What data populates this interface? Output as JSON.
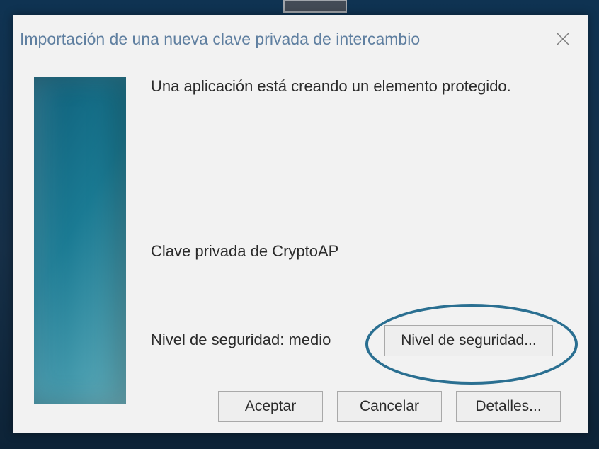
{
  "dialog": {
    "title": "Importación de una nueva clave privada de intercambio",
    "message": "Una aplicación está creando un elemento protegido.",
    "subject": "Clave privada de CryptoAP",
    "security_label": "Nivel de seguridad: medio",
    "buttons": {
      "security_level": "Nivel de seguridad...",
      "accept": "Aceptar",
      "cancel": "Cancelar",
      "details": "Detalles..."
    }
  }
}
